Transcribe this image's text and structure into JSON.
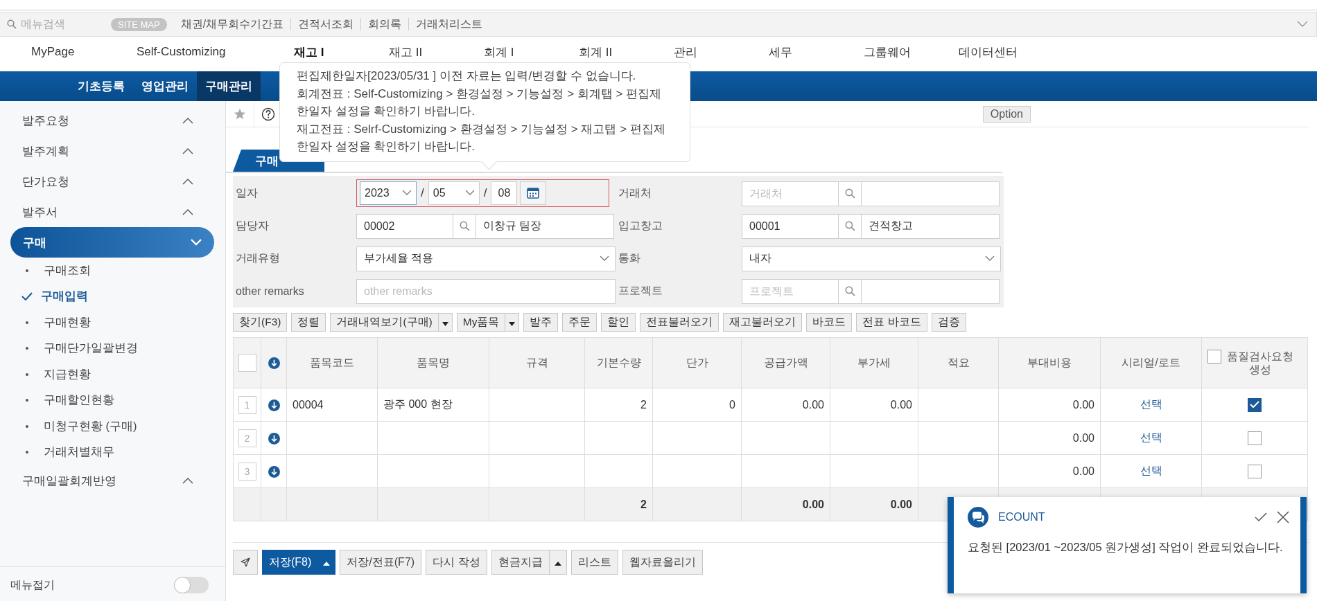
{
  "search_bar": {
    "placeholder": "메뉴검색",
    "site_map": "SITE MAP",
    "links": [
      "채권/채무회수기간표",
      "견적서조회",
      "회의록",
      "거래처리스트"
    ]
  },
  "main_menu": [
    {
      "label": "MyPage",
      "selected": false
    },
    {
      "label": "Self-Customizing",
      "selected": false
    },
    {
      "label": "재고 I",
      "selected": true
    },
    {
      "label": "재고 II",
      "selected": false
    },
    {
      "label": "회계 I",
      "selected": false
    },
    {
      "label": "회계 II",
      "selected": false
    },
    {
      "label": "관리",
      "selected": false
    },
    {
      "label": "세무",
      "selected": false
    },
    {
      "label": "그룹웨어",
      "selected": false
    },
    {
      "label": "데이터센터",
      "selected": false
    }
  ],
  "sub_menu": [
    {
      "label": "기초등록",
      "selected": false
    },
    {
      "label": "영업관리",
      "selected": false
    },
    {
      "label": "구매관리",
      "selected": true
    }
  ],
  "sidebar": {
    "items": [
      {
        "label": "발주요청",
        "expanded": false
      },
      {
        "label": "발주계획",
        "expanded": false
      },
      {
        "label": "단가요청",
        "expanded": false
      },
      {
        "label": "발주서",
        "expanded": false
      },
      {
        "label": "구매",
        "expanded": true,
        "children": [
          {
            "label": "구매조회",
            "selected": false
          },
          {
            "label": "구매입력",
            "selected": true
          },
          {
            "label": "구매현황",
            "selected": false
          },
          {
            "label": "구매단가일괄변경",
            "selected": false
          },
          {
            "label": "지급현황",
            "selected": false
          },
          {
            "label": "구매할인현황",
            "selected": false
          },
          {
            "label": "미청구현황 (구매)",
            "selected": false
          },
          {
            "label": "거래처별채무",
            "selected": false
          }
        ]
      },
      {
        "label": "구매일괄회계반영",
        "expanded": false
      }
    ],
    "collapse_label": "메뉴접기",
    "collapse_on": false
  },
  "toolbar": {
    "option": "Option"
  },
  "tab": {
    "label": "구매"
  },
  "form": {
    "fields": [
      {
        "kind": "date",
        "label": "일자",
        "year": "2023",
        "month": "05",
        "day": "08",
        "separators": [
          "/",
          "/"
        ],
        "invalid": true
      },
      {
        "kind": "lookup",
        "label": "거래처",
        "code_placeholder": "거래처"
      },
      {
        "kind": "lookup",
        "label": "담당자",
        "code": "00002",
        "name": "이창규 팀장"
      },
      {
        "kind": "lookup",
        "label": "입고창고",
        "code": "00001",
        "name": "견적창고"
      },
      {
        "kind": "select",
        "label": "거래유형",
        "value": "부가세율 적용"
      },
      {
        "kind": "select",
        "label": "통화",
        "value": "내자"
      },
      {
        "kind": "text",
        "label": "other remarks",
        "placeholder": "other remarks"
      },
      {
        "kind": "lookup",
        "label": "프로젝트",
        "code_placeholder": "프로젝트"
      }
    ]
  },
  "actions": [
    {
      "label": "찾기(F3)",
      "dropdown": false
    },
    {
      "label": "정렬",
      "dropdown": false
    },
    {
      "label": "거래내역보기(구매)",
      "dropdown": true
    },
    {
      "label": "My품목",
      "dropdown": true
    },
    {
      "label": "발주",
      "dropdown": false
    },
    {
      "label": "주문",
      "dropdown": false
    },
    {
      "label": "할인",
      "dropdown": false
    },
    {
      "label": "전표불러오기",
      "dropdown": false
    },
    {
      "label": "재고불러오기",
      "dropdown": false
    },
    {
      "label": "바코드",
      "dropdown": false
    },
    {
      "label": "전표 바코드",
      "dropdown": false
    },
    {
      "label": "검증",
      "dropdown": false
    }
  ],
  "table": {
    "columns": [
      {
        "label": "품목코드",
        "kind": "text"
      },
      {
        "label": "품목명",
        "kind": "text"
      },
      {
        "label": "규격",
        "kind": "text"
      },
      {
        "label": "기본수량",
        "kind": "number"
      },
      {
        "label": "단가",
        "kind": "number"
      },
      {
        "label": "공급가액",
        "kind": "number"
      },
      {
        "label": "부가세",
        "kind": "number"
      },
      {
        "label": "적요",
        "kind": "text"
      },
      {
        "label": "부대비용",
        "kind": "number"
      },
      {
        "label": "시리얼/로트",
        "kind": "link"
      }
    ],
    "check_column": {
      "label": "품질검사요청생성",
      "checked": false
    },
    "select_all": false,
    "rows": [
      {
        "number": "1",
        "item_code": "00004",
        "item_name": "광주 000 현장",
        "quantity": "2",
        "unit_price": "0",
        "supply_amount": "0.00",
        "vat": "0.00",
        "extra_cost": "0.00",
        "serial": "선택",
        "checked": true
      },
      {
        "number": "2",
        "extra_cost": "0.00",
        "serial": "선택",
        "checked": false
      },
      {
        "number": "3",
        "extra_cost": "0.00",
        "serial": "선택",
        "checked": false
      }
    ],
    "totals": {
      "quantity": "2",
      "supply_amount": "0.00",
      "vat": "0.00"
    }
  },
  "bottom_buttons": [
    {
      "label": "저장(F8)",
      "primary": true,
      "dropdown": true
    },
    {
      "label": "저장/전표(F7)",
      "primary": false,
      "dropdown": false
    },
    {
      "label": "다시 작성",
      "primary": false,
      "dropdown": false
    },
    {
      "label": "현금지급",
      "primary": false,
      "dropdown": true
    },
    {
      "label": "리스트",
      "primary": false,
      "dropdown": false
    },
    {
      "label": "웹자료올리기",
      "primary": false,
      "dropdown": false
    }
  ],
  "tooltip": {
    "lines": [
      "편집제한일자[2023/05/31 ] 이전 자료는 입력/변경할 수 없습니다.",
      "회계전표 : Self-Customizing > 환경설정 > 기능설정 > 회계탭 > 편집제한일자 설정을 확인하기 바랍니다.",
      "재고전표 : Selrf-Customizing > 환경설정 > 기능설정 > 재고탭 > 편집제한일자 설정을 확인하기 바랍니다."
    ]
  },
  "notification": {
    "title": "ECOUNT",
    "message": "요청된 [2023/01 ~2023/05 원가생성] 작업이 완료되었습니다."
  }
}
